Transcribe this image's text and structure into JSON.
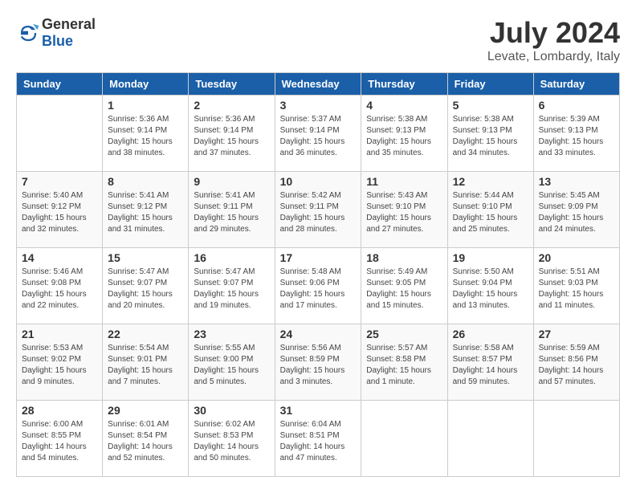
{
  "header": {
    "logo": {
      "text_general": "General",
      "text_blue": "Blue"
    },
    "title": "July 2024",
    "location": "Levate, Lombardy, Italy"
  },
  "calendar": {
    "columns": [
      "Sunday",
      "Monday",
      "Tuesday",
      "Wednesday",
      "Thursday",
      "Friday",
      "Saturday"
    ],
    "weeks": [
      [
        {
          "day": "",
          "sunrise": "",
          "sunset": "",
          "daylight": ""
        },
        {
          "day": "1",
          "sunrise": "Sunrise: 5:36 AM",
          "sunset": "Sunset: 9:14 PM",
          "daylight": "Daylight: 15 hours and 38 minutes."
        },
        {
          "day": "2",
          "sunrise": "Sunrise: 5:36 AM",
          "sunset": "Sunset: 9:14 PM",
          "daylight": "Daylight: 15 hours and 37 minutes."
        },
        {
          "day": "3",
          "sunrise": "Sunrise: 5:37 AM",
          "sunset": "Sunset: 9:14 PM",
          "daylight": "Daylight: 15 hours and 36 minutes."
        },
        {
          "day": "4",
          "sunrise": "Sunrise: 5:38 AM",
          "sunset": "Sunset: 9:13 PM",
          "daylight": "Daylight: 15 hours and 35 minutes."
        },
        {
          "day": "5",
          "sunrise": "Sunrise: 5:38 AM",
          "sunset": "Sunset: 9:13 PM",
          "daylight": "Daylight: 15 hours and 34 minutes."
        },
        {
          "day": "6",
          "sunrise": "Sunrise: 5:39 AM",
          "sunset": "Sunset: 9:13 PM",
          "daylight": "Daylight: 15 hours and 33 minutes."
        }
      ],
      [
        {
          "day": "7",
          "sunrise": "Sunrise: 5:40 AM",
          "sunset": "Sunset: 9:12 PM",
          "daylight": "Daylight: 15 hours and 32 minutes."
        },
        {
          "day": "8",
          "sunrise": "Sunrise: 5:41 AM",
          "sunset": "Sunset: 9:12 PM",
          "daylight": "Daylight: 15 hours and 31 minutes."
        },
        {
          "day": "9",
          "sunrise": "Sunrise: 5:41 AM",
          "sunset": "Sunset: 9:11 PM",
          "daylight": "Daylight: 15 hours and 29 minutes."
        },
        {
          "day": "10",
          "sunrise": "Sunrise: 5:42 AM",
          "sunset": "Sunset: 9:11 PM",
          "daylight": "Daylight: 15 hours and 28 minutes."
        },
        {
          "day": "11",
          "sunrise": "Sunrise: 5:43 AM",
          "sunset": "Sunset: 9:10 PM",
          "daylight": "Daylight: 15 hours and 27 minutes."
        },
        {
          "day": "12",
          "sunrise": "Sunrise: 5:44 AM",
          "sunset": "Sunset: 9:10 PM",
          "daylight": "Daylight: 15 hours and 25 minutes."
        },
        {
          "day": "13",
          "sunrise": "Sunrise: 5:45 AM",
          "sunset": "Sunset: 9:09 PM",
          "daylight": "Daylight: 15 hours and 24 minutes."
        }
      ],
      [
        {
          "day": "14",
          "sunrise": "Sunrise: 5:46 AM",
          "sunset": "Sunset: 9:08 PM",
          "daylight": "Daylight: 15 hours and 22 minutes."
        },
        {
          "day": "15",
          "sunrise": "Sunrise: 5:47 AM",
          "sunset": "Sunset: 9:07 PM",
          "daylight": "Daylight: 15 hours and 20 minutes."
        },
        {
          "day": "16",
          "sunrise": "Sunrise: 5:47 AM",
          "sunset": "Sunset: 9:07 PM",
          "daylight": "Daylight: 15 hours and 19 minutes."
        },
        {
          "day": "17",
          "sunrise": "Sunrise: 5:48 AM",
          "sunset": "Sunset: 9:06 PM",
          "daylight": "Daylight: 15 hours and 17 minutes."
        },
        {
          "day": "18",
          "sunrise": "Sunrise: 5:49 AM",
          "sunset": "Sunset: 9:05 PM",
          "daylight": "Daylight: 15 hours and 15 minutes."
        },
        {
          "day": "19",
          "sunrise": "Sunrise: 5:50 AM",
          "sunset": "Sunset: 9:04 PM",
          "daylight": "Daylight: 15 hours and 13 minutes."
        },
        {
          "day": "20",
          "sunrise": "Sunrise: 5:51 AM",
          "sunset": "Sunset: 9:03 PM",
          "daylight": "Daylight: 15 hours and 11 minutes."
        }
      ],
      [
        {
          "day": "21",
          "sunrise": "Sunrise: 5:53 AM",
          "sunset": "Sunset: 9:02 PM",
          "daylight": "Daylight: 15 hours and 9 minutes."
        },
        {
          "day": "22",
          "sunrise": "Sunrise: 5:54 AM",
          "sunset": "Sunset: 9:01 PM",
          "daylight": "Daylight: 15 hours and 7 minutes."
        },
        {
          "day": "23",
          "sunrise": "Sunrise: 5:55 AM",
          "sunset": "Sunset: 9:00 PM",
          "daylight": "Daylight: 15 hours and 5 minutes."
        },
        {
          "day": "24",
          "sunrise": "Sunrise: 5:56 AM",
          "sunset": "Sunset: 8:59 PM",
          "daylight": "Daylight: 15 hours and 3 minutes."
        },
        {
          "day": "25",
          "sunrise": "Sunrise: 5:57 AM",
          "sunset": "Sunset: 8:58 PM",
          "daylight": "Daylight: 15 hours and 1 minute."
        },
        {
          "day": "26",
          "sunrise": "Sunrise: 5:58 AM",
          "sunset": "Sunset: 8:57 PM",
          "daylight": "Daylight: 14 hours and 59 minutes."
        },
        {
          "day": "27",
          "sunrise": "Sunrise: 5:59 AM",
          "sunset": "Sunset: 8:56 PM",
          "daylight": "Daylight: 14 hours and 57 minutes."
        }
      ],
      [
        {
          "day": "28",
          "sunrise": "Sunrise: 6:00 AM",
          "sunset": "Sunset: 8:55 PM",
          "daylight": "Daylight: 14 hours and 54 minutes."
        },
        {
          "day": "29",
          "sunrise": "Sunrise: 6:01 AM",
          "sunset": "Sunset: 8:54 PM",
          "daylight": "Daylight: 14 hours and 52 minutes."
        },
        {
          "day": "30",
          "sunrise": "Sunrise: 6:02 AM",
          "sunset": "Sunset: 8:53 PM",
          "daylight": "Daylight: 14 hours and 50 minutes."
        },
        {
          "day": "31",
          "sunrise": "Sunrise: 6:04 AM",
          "sunset": "Sunset: 8:51 PM",
          "daylight": "Daylight: 14 hours and 47 minutes."
        },
        {
          "day": "",
          "sunrise": "",
          "sunset": "",
          "daylight": ""
        },
        {
          "day": "",
          "sunrise": "",
          "sunset": "",
          "daylight": ""
        },
        {
          "day": "",
          "sunrise": "",
          "sunset": "",
          "daylight": ""
        }
      ]
    ]
  }
}
